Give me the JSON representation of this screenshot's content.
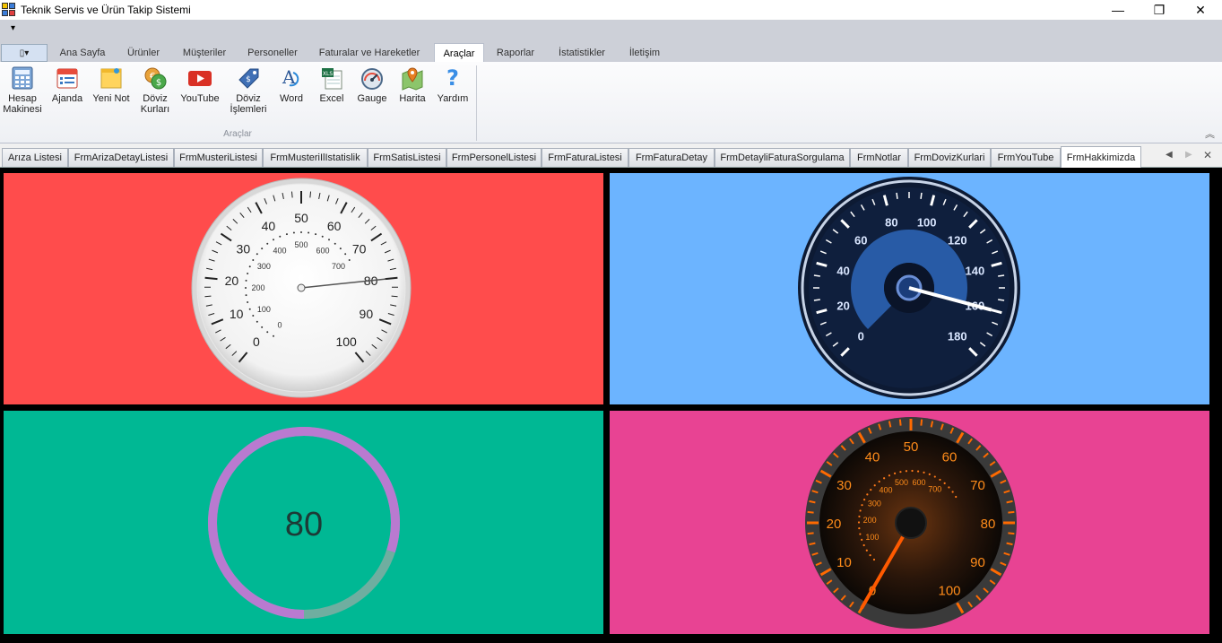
{
  "window": {
    "title": "Teknik Servis ve Ürün Takip Sistemi",
    "minimize": "—",
    "maximize": "❐",
    "close": "✕"
  },
  "qat": {
    "dropdown": "▾"
  },
  "app_button": "▯▾",
  "ribbon_tabs": [
    {
      "label": "Ana Sayfa"
    },
    {
      "label": "Ürünler"
    },
    {
      "label": "Müşteriler"
    },
    {
      "label": "Personeller"
    },
    {
      "label": "Faturalar ve Hareketler"
    },
    {
      "label": "Araçlar"
    },
    {
      "label": "Raporlar"
    },
    {
      "label": "İstatistikler"
    },
    {
      "label": "İletişim"
    }
  ],
  "active_ribbon_tab": "Araçlar",
  "tools": [
    {
      "label": "Hesap\nMakinesi",
      "icon": "calculator-icon"
    },
    {
      "label": "Ajanda",
      "icon": "calendar-icon"
    },
    {
      "label": "Yeni Not",
      "icon": "note-icon"
    },
    {
      "label": "Döviz\nKurları",
      "icon": "currency-icon"
    },
    {
      "label": "YouTube",
      "icon": "youtube-icon"
    },
    {
      "label": "Döviz\nİşlemleri",
      "icon": "price-tag-icon"
    },
    {
      "label": "Word",
      "icon": "word-icon"
    },
    {
      "label": "Excel",
      "icon": "excel-icon"
    },
    {
      "label": "Gauge",
      "icon": "gauge-icon"
    },
    {
      "label": "Harita",
      "icon": "map-icon"
    },
    {
      "label": "Yardım",
      "icon": "help-icon"
    }
  ],
  "group_label": "Araçlar",
  "mdi_tabs": [
    {
      "label": "Arıza Listesi"
    },
    {
      "label": "FrmArizaDetayListesi"
    },
    {
      "label": "FrmMusteriListesi"
    },
    {
      "label": "FrmMusteriIlIstatislik"
    },
    {
      "label": "FrmSatisListesi"
    },
    {
      "label": "FrmPersonelListesi"
    },
    {
      "label": "FrmFaturaListesi"
    },
    {
      "label": "FrmFaturaDetay"
    },
    {
      "label": "FrmDetayliFaturaSorgulama"
    },
    {
      "label": "FrmNotlar"
    },
    {
      "label": "FrmDovizKurlari"
    },
    {
      "label": "FrmYouTube"
    },
    {
      "label": "FrmHakkimizda"
    }
  ],
  "active_mdi_tab": "FrmHakkimizda",
  "gauges": {
    "white": {
      "bg": "#ff4c4c",
      "outer_labels": [
        "0",
        "10",
        "20",
        "30",
        "40",
        "50",
        "60",
        "70",
        "80",
        "90",
        "100"
      ],
      "inner_labels": [
        "0",
        "100",
        "200",
        "300",
        "400",
        "500",
        "600",
        "700"
      ],
      "value": 80
    },
    "blue": {
      "bg": "#6cb4ff",
      "labels": [
        "0",
        "20",
        "40",
        "60",
        "80",
        "100",
        "120",
        "140",
        "160",
        "180"
      ],
      "value": 160
    },
    "ring": {
      "bg": "#00b894",
      "value_text": "80",
      "ring_color": "#b97ad0"
    },
    "orange": {
      "bg": "#e84393",
      "outer_labels": [
        "0",
        "10",
        "20",
        "30",
        "40",
        "50",
        "60",
        "70",
        "80",
        "90",
        "100"
      ],
      "inner_labels": [
        "100",
        "200",
        "300",
        "400",
        "500",
        "600",
        "700"
      ],
      "value": 0
    }
  }
}
